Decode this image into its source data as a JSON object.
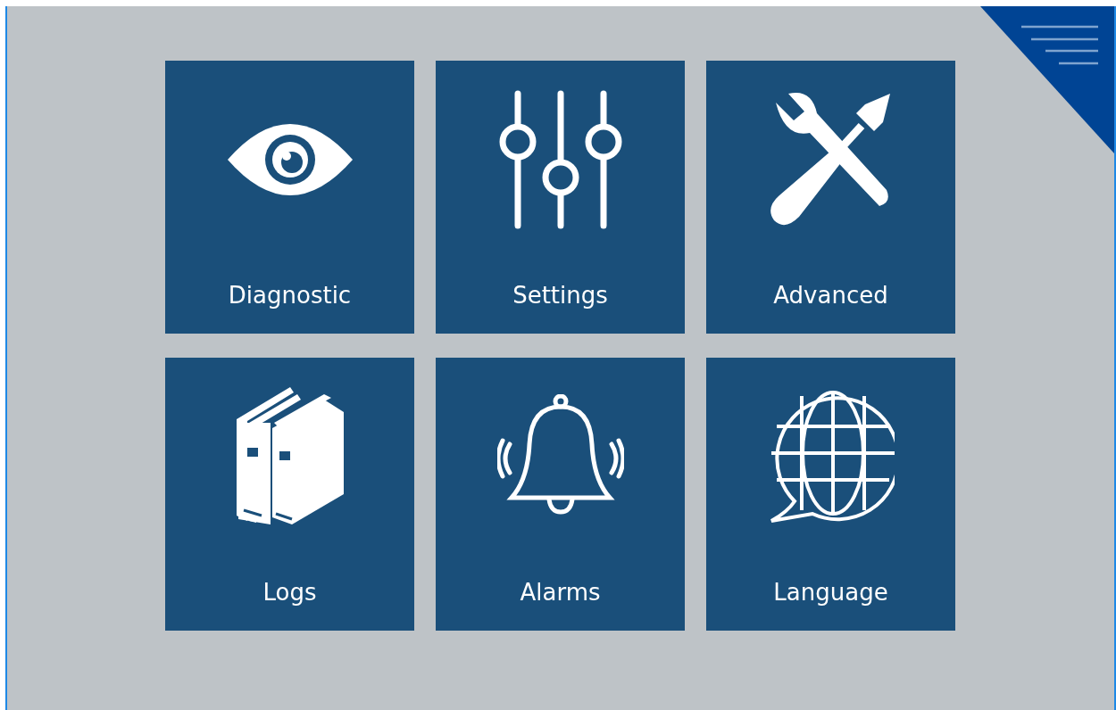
{
  "menu_button": {
    "kind": "hamburger"
  },
  "tiles": [
    {
      "label": "Diagnostic",
      "kind": "eye"
    },
    {
      "label": "Settings",
      "kind": "sliders"
    },
    {
      "label": "Advanced",
      "kind": "tools"
    },
    {
      "label": "Logs",
      "kind": "books"
    },
    {
      "label": "Alarms",
      "kind": "bell"
    },
    {
      "label": "Language",
      "kind": "globe"
    }
  ]
}
